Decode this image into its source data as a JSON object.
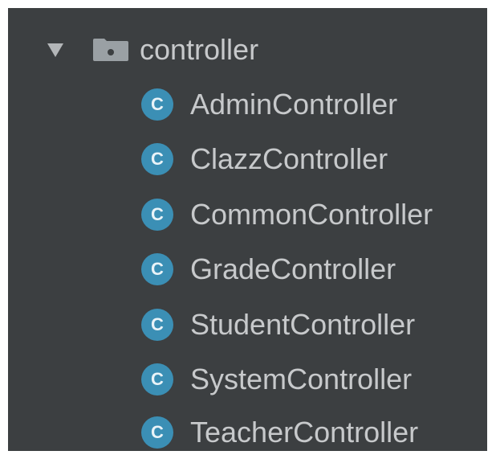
{
  "tree": {
    "folder": {
      "name": "controller",
      "expanded": true,
      "icon": "folder-icon",
      "toggle_icon": "chevron-down-icon"
    },
    "class_icon_letter": "C",
    "class_icon_color": "#3b8fb5",
    "items": [
      {
        "label": "AdminController"
      },
      {
        "label": "ClazzController"
      },
      {
        "label": "CommonController"
      },
      {
        "label": "GradeController"
      },
      {
        "label": "StudentController"
      },
      {
        "label": "SystemController"
      },
      {
        "label": "TeacherController"
      }
    ]
  },
  "colors": {
    "background": "#3c3f41",
    "text": "#c7c9cb",
    "folder_icon": "#9aa0a4"
  }
}
